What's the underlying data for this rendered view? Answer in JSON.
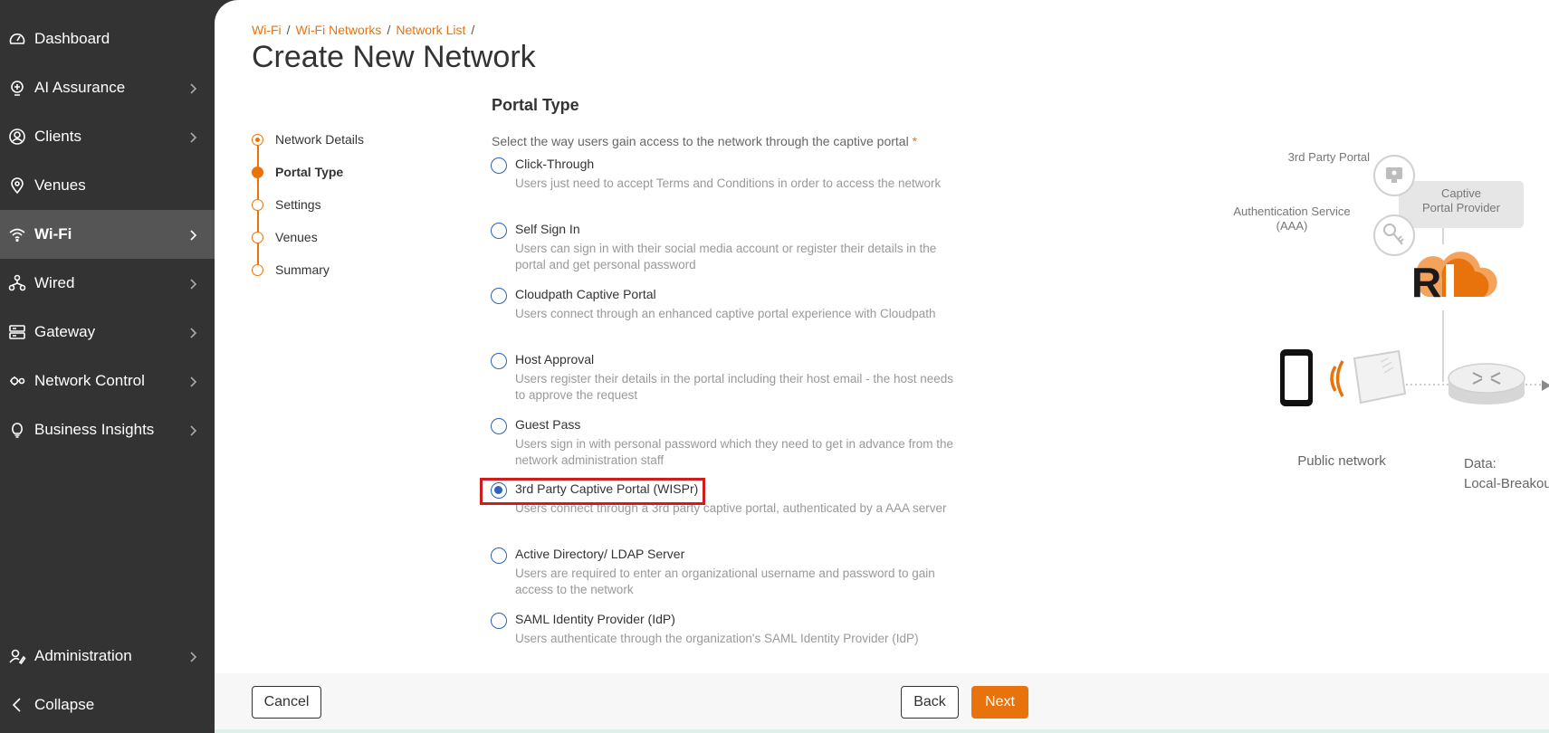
{
  "sidebar": {
    "items": [
      {
        "label": "Dashboard",
        "icon": "gauge-icon",
        "chevron": false
      },
      {
        "label": "AI Assurance",
        "icon": "ai-assurance-icon",
        "chevron": true
      },
      {
        "label": "Clients",
        "icon": "user-circle-icon",
        "chevron": true
      },
      {
        "label": "Venues",
        "icon": "location-pin-icon",
        "chevron": false
      },
      {
        "label": "Wi-Fi",
        "icon": "wifi-icon",
        "chevron": true,
        "active": true
      },
      {
        "label": "Wired",
        "icon": "wired-network-icon",
        "chevron": true
      },
      {
        "label": "Gateway",
        "icon": "gateway-server-icon",
        "chevron": true
      },
      {
        "label": "Network Control",
        "icon": "gears-icon",
        "chevron": true
      },
      {
        "label": "Business Insights",
        "icon": "lightbulb-icon",
        "chevron": true
      }
    ],
    "administration": "Administration",
    "collapse": "Collapse"
  },
  "breadcrumb": [
    "Wi-Fi",
    "Wi-Fi Networks",
    "Network List"
  ],
  "breadcrumb_separator": "/",
  "page_title": "Create New Network",
  "steps": [
    {
      "label": "Network Details",
      "state": "done"
    },
    {
      "label": "Portal Type",
      "state": "current"
    },
    {
      "label": "Settings",
      "state": "pending"
    },
    {
      "label": "Venues",
      "state": "pending"
    },
    {
      "label": "Summary",
      "state": "pending"
    }
  ],
  "portal": {
    "section_title": "Portal Type",
    "question": "Select the way users gain access to the network through the captive portal",
    "required_mark": "*",
    "selected": "3rd Party Captive Portal (WISPr)",
    "options": [
      {
        "label": "Click-Through",
        "desc": "Users just need to accept Terms and Conditions in order to access the network"
      },
      {
        "label": "Self Sign In",
        "desc": "Users can sign in with their social media account or register their details in the portal and get personal password"
      },
      {
        "label": "Cloudpath Captive Portal",
        "desc": "Users connect through an enhanced captive portal experience with Cloudpath"
      },
      {
        "label": "Host Approval",
        "desc": "Users register their details in the portal including their host email - the host needs to approve the request"
      },
      {
        "label": "Guest Pass",
        "desc": "Users sign in with personal password which they need to get in advance from the network administration staff"
      },
      {
        "label": "3rd Party Captive Portal (WISPr)",
        "desc": "Users connect through a 3rd party captive portal, authenticated by a AAA server"
      },
      {
        "label": "Active Directory/ LDAP Server",
        "desc": "Users are required to enter an organizational username and password to gain access to the network"
      },
      {
        "label": "SAML Identity Provider (IdP)",
        "desc": "Users authenticate through the organization's SAML Identity Provider (IdP)"
      }
    ]
  },
  "diagram": {
    "third_party_portal": "3rd Party Portal",
    "auth_service": "Authentication Service",
    "auth_service_abbr": "(AAA)",
    "captive_provider_1": "Captive",
    "captive_provider_2": "Portal Provider",
    "public_network": "Public network",
    "data_1": "Data:",
    "data_2": "Local-Breakout",
    "logo_text": "R1"
  },
  "footer": {
    "cancel": "Cancel",
    "back": "Back",
    "next": "Next"
  },
  "colors": {
    "accent": "#e8730c",
    "sidebar_bg": "#333333",
    "radio_blue": "#2e63b8",
    "highlight_red": "#d01c1c"
  }
}
